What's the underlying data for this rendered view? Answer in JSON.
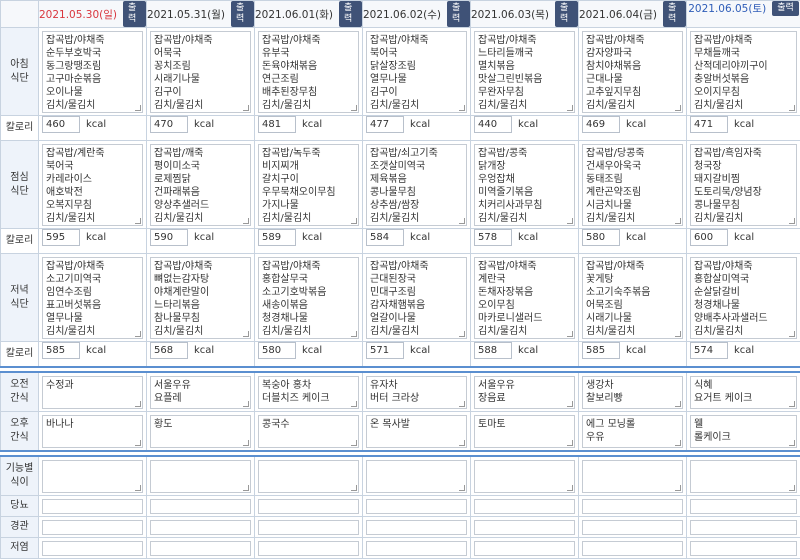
{
  "days": [
    {
      "date": "2021.05.30(일)",
      "type": "sun",
      "print_label": "출력",
      "breakfast": [
        "잡곡밥/야채죽",
        "순두부호박국",
        "동그랑땡조림",
        "고구마순볶음",
        "오이나물",
        "김치/물김치"
      ],
      "breakfast_kcal": "460",
      "lunch": [
        "잡곡밥/계란죽",
        "북어국",
        "카레라이스",
        "애호박전",
        "오복지무침",
        "김치/물김치"
      ],
      "lunch_kcal": "595",
      "dinner": [
        "잡곡밥/야채죽",
        "소고기미역국",
        "임연수조림",
        "표고버섯볶음",
        "열무나물",
        "김치/물김치"
      ],
      "dinner_kcal": "585",
      "am_snack": "수정과",
      "pm_snack": "바나나"
    },
    {
      "date": "2021.05.31(월)",
      "type": "normal",
      "print_label": "출력",
      "breakfast": [
        "잡곡밥/야채죽",
        "어묵국",
        "꽁치조림",
        "시래기나물",
        "김구이",
        "김치/물김치"
      ],
      "breakfast_kcal": "470",
      "lunch": [
        "잡곡밥/깨죽",
        "평이미소국",
        "로제찜닭",
        "건파래볶음",
        "양상추샐러드",
        "김치/물김치"
      ],
      "lunch_kcal": "590",
      "dinner": [
        "잡곡밥/야채죽",
        "뼈없는감자탕",
        "야채계란말이",
        "느타리볶음",
        "참나물무침",
        "김치/물김치"
      ],
      "dinner_kcal": "568",
      "am_snack": "서울우유\n요플레",
      "pm_snack": "황도"
    },
    {
      "date": "2021.06.01(화)",
      "type": "normal",
      "print_label": "출력",
      "breakfast": [
        "잡곡밥/야채죽",
        "유부국",
        "돈육야채볶음",
        "연근조림",
        "배추된장무침",
        "김치/물김치"
      ],
      "breakfast_kcal": "481",
      "lunch": [
        "잡곡밥/녹두죽",
        "비지찌개",
        "갈치구이",
        "우무묵채오이무침",
        "가지나물",
        "김치/물김치"
      ],
      "lunch_kcal": "589",
      "dinner": [
        "잡곡밥/야채죽",
        "홍합살무국",
        "소고기호박볶음",
        "새송이볶음",
        "청경채나물",
        "김치/물김치"
      ],
      "dinner_kcal": "580",
      "am_snack": "복숭아 홍차\n더블치즈 케이크",
      "pm_snack": "콩국수"
    },
    {
      "date": "2021.06.02(수)",
      "type": "normal",
      "print_label": "출력",
      "breakfast": [
        "잡곡밥/야채죽",
        "북어국",
        "닭살장조림",
        "열무나물",
        "김구이",
        "김치/물김치"
      ],
      "breakfast_kcal": "477",
      "lunch": [
        "잡곡밥/쇠고기죽",
        "조갯살미역국",
        "제육볶음",
        "콩나물무침",
        "상추쌈/쌈장",
        "김치/물김치"
      ],
      "lunch_kcal": "584",
      "dinner": [
        "잡곡밥/야채죽",
        "근대된장국",
        "민대구조림",
        "감자채햄볶음",
        "얼갈이나물",
        "김치/물김치"
      ],
      "dinner_kcal": "571",
      "am_snack": "유자차\n버터 크라상",
      "pm_snack": "온 목사발"
    },
    {
      "date": "2021.06.03(목)",
      "type": "normal",
      "print_label": "출력",
      "breakfast": [
        "잡곡밥/야채죽",
        "느타리들깨국",
        "멸치볶음",
        "맛살그린빈볶음",
        "무완자무침",
        "김치/물김치"
      ],
      "breakfast_kcal": "440",
      "lunch": [
        "잡곡밥/콩죽",
        "닭개장",
        "우엉잡채",
        "미역줄기볶음",
        "치커리사과무침",
        "김치/물김치"
      ],
      "lunch_kcal": "578",
      "dinner": [
        "잡곡밥/야채죽",
        "계란국",
        "돈채자장볶음",
        "오이무침",
        "마카로니샐러드",
        "김치/물김치"
      ],
      "dinner_kcal": "588",
      "am_snack": "서울우유\n장음료",
      "pm_snack": "토마토"
    },
    {
      "date": "2021.06.04(금)",
      "type": "normal",
      "print_label": "출력",
      "breakfast": [
        "잡곡밥/야채죽",
        "감자양파국",
        "참치야채볶음",
        "근대나물",
        "고추잎지무침",
        "김치/물김치"
      ],
      "breakfast_kcal": "469",
      "lunch": [
        "잡곡밥/당콩죽",
        "건새우아욱국",
        "동태조림",
        "계란곤약조림",
        "시금치나물",
        "김치/물김치"
      ],
      "lunch_kcal": "580",
      "dinner": [
        "잡곡밥/야채죽",
        "꽃게탕",
        "소고기숙주볶음",
        "어묵조림",
        "시래기나물",
        "김치/물김치"
      ],
      "dinner_kcal": "585",
      "am_snack": "생강차\n찰보리빵",
      "pm_snack": "에그 모닝롤\n우유"
    },
    {
      "date": "2021.06.05(토)",
      "type": "sat",
      "print_label": "출력",
      "breakfast": [
        "잡곡밥/야채죽",
        "무채들깨국",
        "산적데리야끼구이",
        "충알버섯볶음",
        "오이지무침",
        "김치/물김치"
      ],
      "breakfast_kcal": "471",
      "lunch": [
        "잡곡밥/흑임자죽",
        "청국장",
        "돼지갈비찜",
        "도토리묵/양념장",
        "콩나물무침",
        "김치/물김치"
      ],
      "lunch_kcal": "600",
      "dinner": [
        "잡곡밥/야채죽",
        "홍합살미역국",
        "순살닭갈비",
        "청경채나물",
        "양배추사과샐러드",
        "김치/물김치"
      ],
      "dinner_kcal": "574",
      "am_snack": "식혜\n요거트 케이크",
      "pm_snack": "웰\n롤케이크"
    }
  ],
  "labels": {
    "breakfast": "아침\n식단",
    "lunch": "점심\n식단",
    "dinner": "저녁\n식단",
    "calorie": "칼로리",
    "kcal_unit": "kcal",
    "am_snack": "오전\n간식",
    "pm_snack": "오후\n간식",
    "functional": "기능별\n식이",
    "sugar": "당뇨",
    "tube": "경관",
    "low_salt": "저염"
  }
}
